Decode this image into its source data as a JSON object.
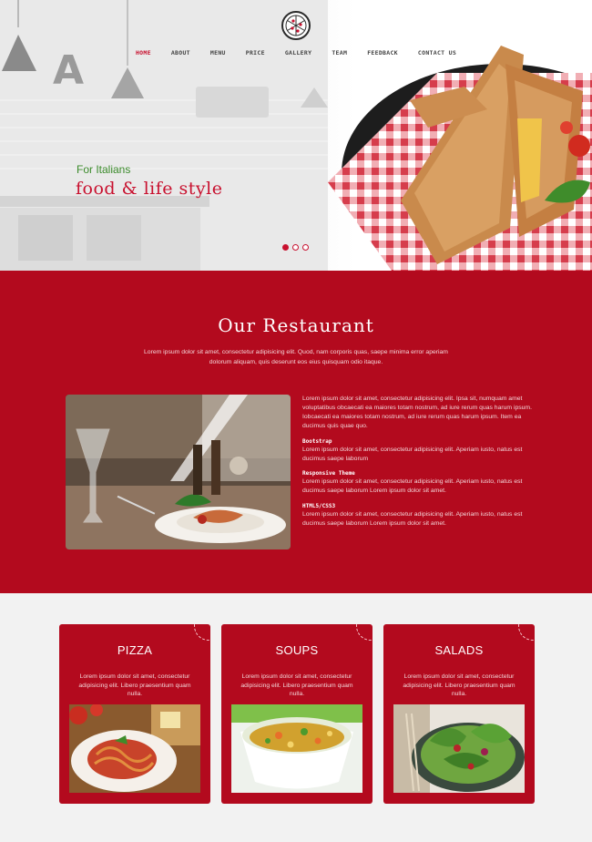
{
  "header": {
    "logo_icon": "pizza-logo-icon",
    "nav": [
      {
        "label": "HOME",
        "active": true
      },
      {
        "label": "ABOUT",
        "active": false
      },
      {
        "label": "MENU",
        "active": false
      },
      {
        "label": "PRICE",
        "active": false
      },
      {
        "label": "GALLERY",
        "active": false
      },
      {
        "label": "TEAM",
        "active": false
      },
      {
        "label": "FEEDBACK",
        "active": false
      },
      {
        "label": "CONTACT US",
        "active": false
      }
    ]
  },
  "hero": {
    "tagline": "For Italians",
    "headline": "food & life style",
    "slides": 3,
    "active_slide": 1
  },
  "restaurant": {
    "title": "Our Restaurant",
    "intro": "Lorem ipsum dolor sit amet, consectetur adipisicing elit. Quod, nam corporis quas, saepe minima error aperiam dolorum aliquam, quis deserunt eos eius quisquam odio itaque.",
    "paragraph": "Lorem ipsum dolor sit amet, consectetur adipisicing elit. Ipsa sit, numquam amet voluptatibus obcaecati ea maiores totam nostrum, ad iure rerum quas harum ipsum. Iobcaecati ea maiores totam nostrum, ad iure rerum quas harum ipsum. Item ea ducimus quis quae quo.",
    "features": [
      {
        "title": "Bootstrap",
        "text": "Lorem ipsum dolor sit amet, consectetur adipisicing elit. Aperiam iusto, natus est ducimus saepe laborum"
      },
      {
        "title": "Responsive Theme",
        "text": "Lorem ipsum dolor sit amet, consectetur adipisicing elit. Aperiam iusto, natus est ducimus saepe laborum Lorem ipsum dolor sit amet."
      },
      {
        "title": "HTML5/CSS3",
        "text": "Lorem ipsum dolor sit amet, consectetur adipisicing elit. Aperiam iusto, natus est ducimus saepe laborum Lorem ipsum dolor sit amet."
      }
    ]
  },
  "cards": [
    {
      "title": "PIZZA",
      "text": "Lorem ipsum dolor sit amet, consectetur adipisicing elit. Libero praesentium quam nulla."
    },
    {
      "title": "SOUPS",
      "text": "Lorem ipsum dolor sit amet, consectetur adipisicing elit. Libero praesentium quam nulla."
    },
    {
      "title": "SALADS",
      "text": "Lorem ipsum dolor sit amet, consectetur adipisicing elit. Libero praesentium quam nulla."
    }
  ],
  "colors": {
    "brand_red": "#b30a1e",
    "accent_red": "#c8102e",
    "tagline_green": "#3a8a2a"
  }
}
